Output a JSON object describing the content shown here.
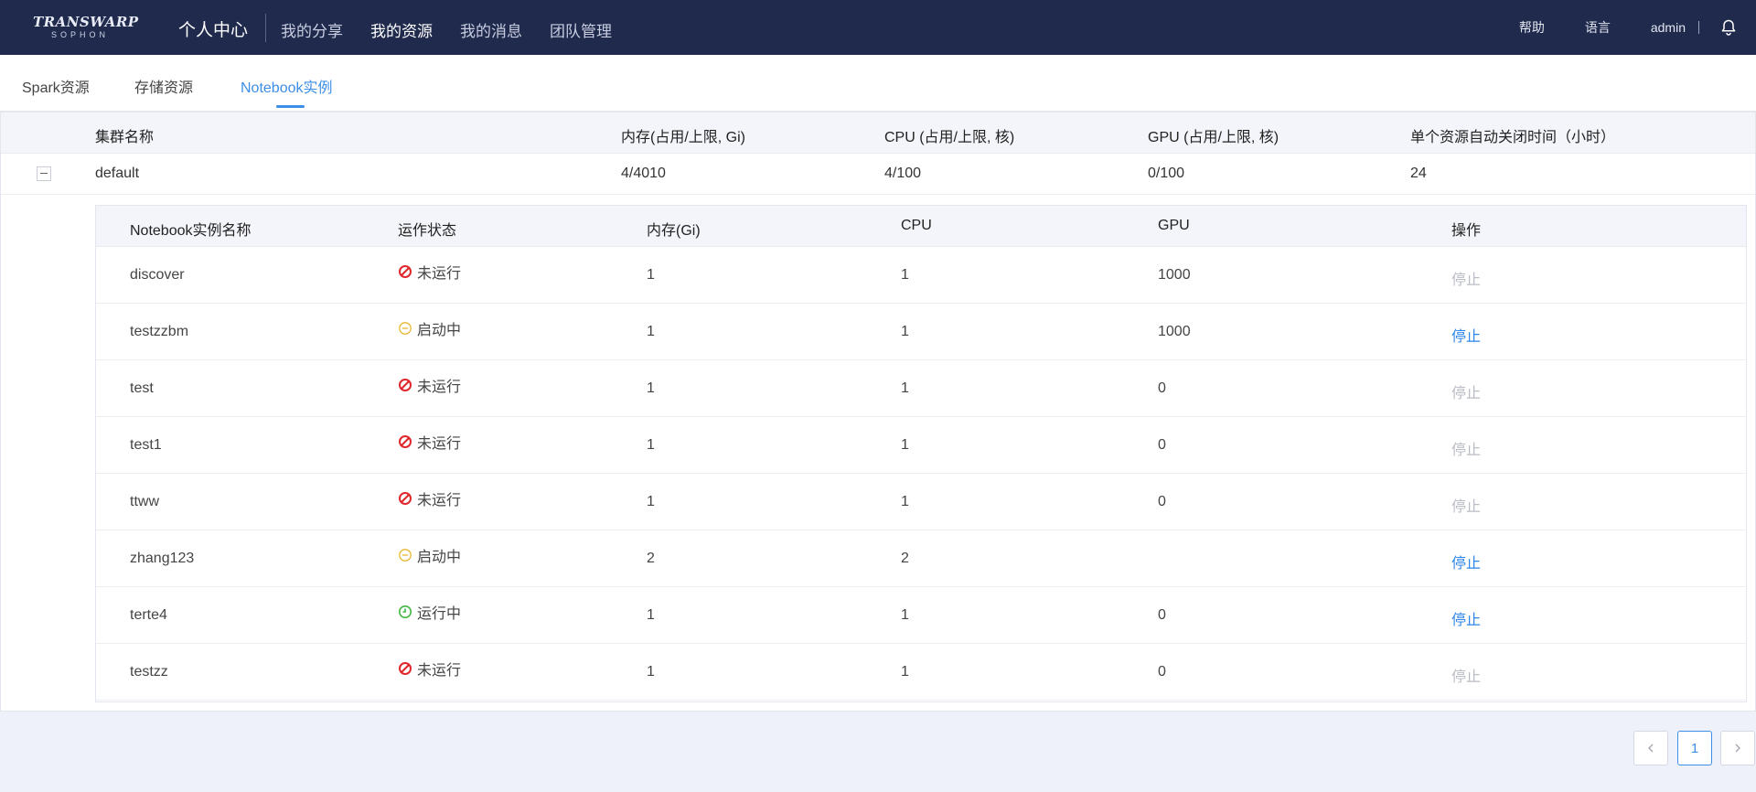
{
  "topbar": {
    "logo_main": "TRANSWARP",
    "logo_sub": "SOPHON",
    "title": "个人中心",
    "nav": [
      {
        "label": "我的分享",
        "active": false
      },
      {
        "label": "我的资源",
        "active": true
      },
      {
        "label": "我的消息",
        "active": false
      },
      {
        "label": "团队管理",
        "active": false
      }
    ],
    "help": "帮助",
    "language": "语言",
    "user": "admin",
    "bell_icon": "bell-icon"
  },
  "tabs": [
    {
      "label": "Spark资源",
      "active": false
    },
    {
      "label": "存储资源",
      "active": false
    },
    {
      "label": "Notebook实例",
      "active": true
    }
  ],
  "cluster_table": {
    "headers": [
      "集群名称",
      "内存(占用/上限, Gi)",
      "CPU (占用/上限, 核)",
      "GPU (占用/上限, 核)",
      "单个资源自动关闭时间（小时）"
    ],
    "row": {
      "name": "default",
      "memory": "4/4010",
      "cpu": "4/100",
      "gpu": "0/100",
      "auto_close": "24"
    }
  },
  "instances": {
    "headers": [
      "Notebook实例名称",
      "运作状态",
      "内存(Gi)",
      "CPU",
      "GPU",
      "操作"
    ],
    "rows": [
      {
        "name": "discover",
        "status": "未运行",
        "status_type": "stopped",
        "memory": "1",
        "cpu": "1",
        "gpu": "1000",
        "action": "停止",
        "action_enabled": false
      },
      {
        "name": "testzzbm",
        "status": "启动中",
        "status_type": "starting",
        "memory": "1",
        "cpu": "1",
        "gpu": "1000",
        "action": "停止",
        "action_enabled": true
      },
      {
        "name": "test",
        "status": "未运行",
        "status_type": "stopped",
        "memory": "1",
        "cpu": "1",
        "gpu": "0",
        "action": "停止",
        "action_enabled": false
      },
      {
        "name": "test1",
        "status": "未运行",
        "status_type": "stopped",
        "memory": "1",
        "cpu": "1",
        "gpu": "0",
        "action": "停止",
        "action_enabled": false
      },
      {
        "name": "ttww",
        "status": "未运行",
        "status_type": "stopped",
        "memory": "1",
        "cpu": "1",
        "gpu": "0",
        "action": "停止",
        "action_enabled": false
      },
      {
        "name": "zhang123",
        "status": "启动中",
        "status_type": "starting",
        "memory": "2",
        "cpu": "2",
        "gpu": "",
        "action": "停止",
        "action_enabled": true
      },
      {
        "name": "terte4",
        "status": "运行中",
        "status_type": "running",
        "memory": "1",
        "cpu": "1",
        "gpu": "0",
        "action": "停止",
        "action_enabled": true
      },
      {
        "name": "testzz",
        "status": "未运行",
        "status_type": "stopped",
        "memory": "1",
        "cpu": "1",
        "gpu": "0",
        "action": "停止",
        "action_enabled": false
      }
    ]
  },
  "status_colors": {
    "stopped": "#e0262b",
    "starting": "#e8b730",
    "running": "#3eb83c"
  },
  "pagination": {
    "prev": "<",
    "current": "1",
    "next": ">"
  }
}
